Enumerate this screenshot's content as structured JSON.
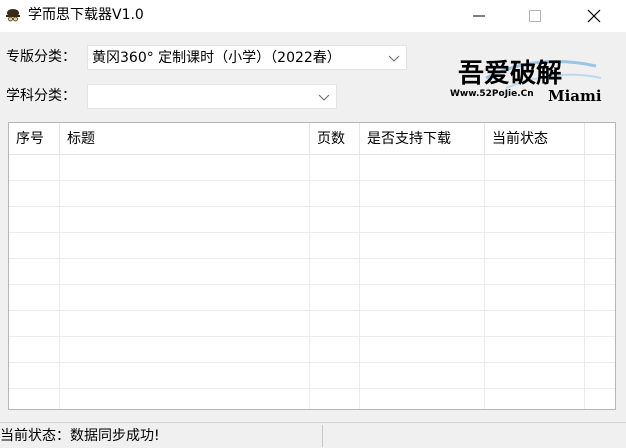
{
  "window": {
    "title": "学而思下载器V1.0",
    "icon": "spy-hat-icon",
    "controls": [
      "minimize-icon",
      "maximize-icon",
      "close-icon"
    ]
  },
  "form": {
    "edition_label": "专版分类：",
    "edition_value": "黄冈360°  定制课时（小学）（2022春）",
    "subject_label": "学科分类：",
    "subject_value": ""
  },
  "logo": {
    "text_main": "吾爱破解",
    "text_url": "Www.52PoJie.Cn",
    "text_side": "Miami"
  },
  "table": {
    "columns": [
      "序号",
      "标题",
      "页数",
      "是否支持下载",
      "当前状态"
    ],
    "rows": []
  },
  "status": {
    "text": "当前状态：数据同步成功!"
  },
  "colors": {
    "window_bg": "#f0f0f0",
    "titlebar_bg": "#ffffff",
    "table_bg": "#ffffff",
    "border": "#b6b6b6"
  }
}
